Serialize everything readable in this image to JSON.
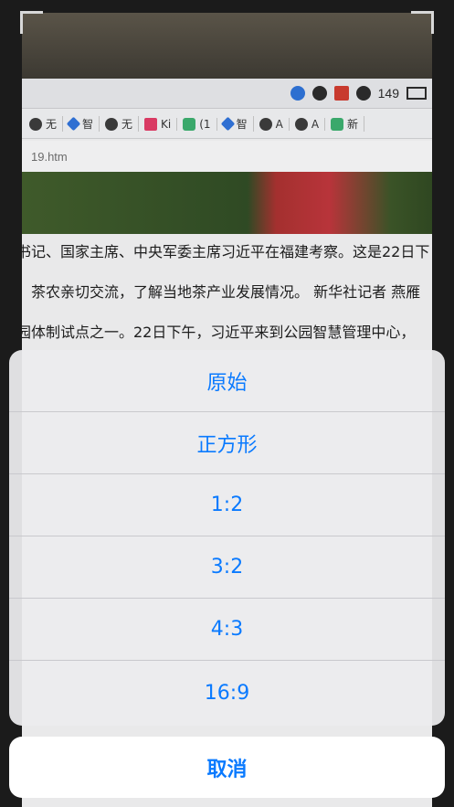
{
  "background": {
    "menubar_number": "149",
    "bookmarks": [
      "无",
      "智",
      "无",
      "Ki",
      "(1",
      "智",
      "A",
      "A",
      "新"
    ],
    "url_fragment": "19.htm",
    "article_lines": [
      "书记、国家主席、中央军委主席习近平在福建考察。这是22日下",
      "，茶农亲切交流，了解当地茶产业发展情况。 新华社记者 燕雁",
      "园体制试点之一。22日下午，习近平来到公园智慧管理中心，"
    ]
  },
  "action_sheet": {
    "options": [
      "原始",
      "正方形",
      "1:2",
      "3:2",
      "4:3",
      "16:9"
    ],
    "cancel_label": "取消",
    "accent_color": "#0A7AFF"
  }
}
